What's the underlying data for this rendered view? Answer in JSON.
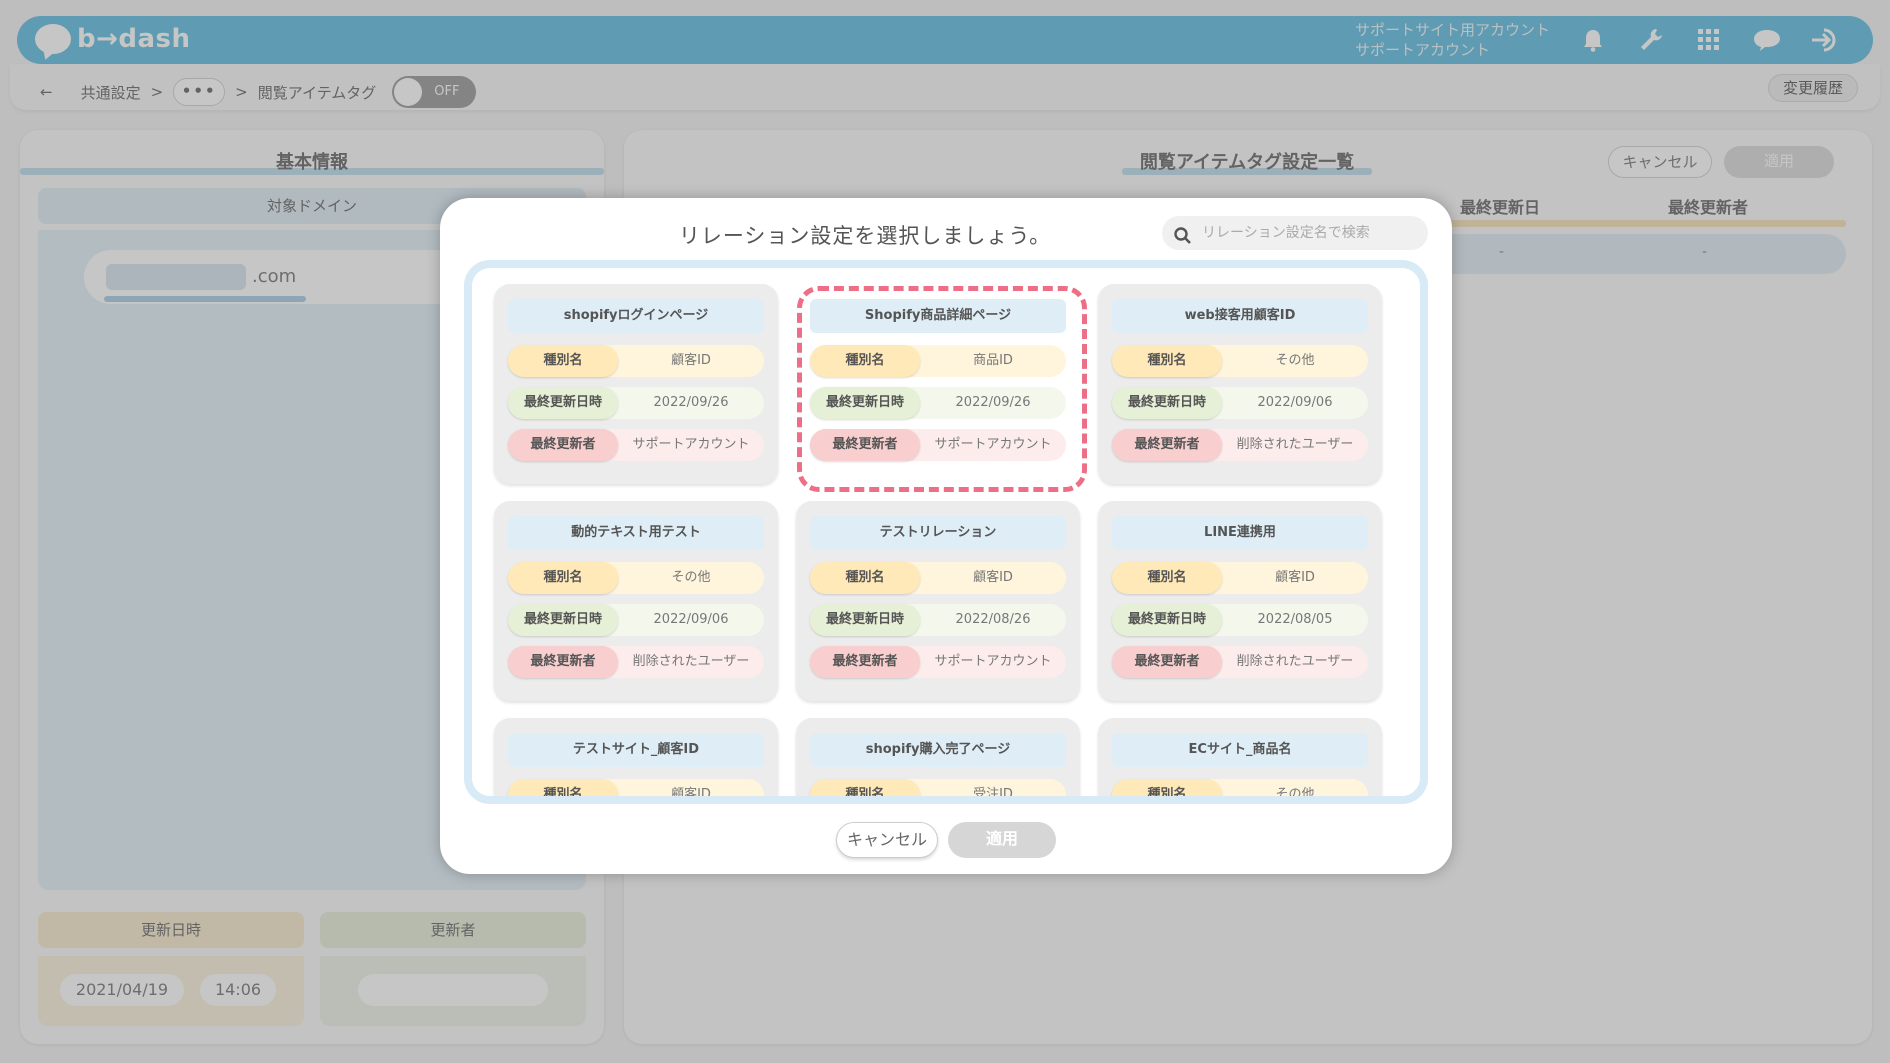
{
  "header": {
    "logo_text": "b→dash",
    "account_site": "サポートサイト用アカウント",
    "account_user": "サポートアカウント",
    "icons": [
      "bell-icon",
      "wrench-icon",
      "grid-icon",
      "support-chat-icon",
      "logout-icon"
    ]
  },
  "subbar": {
    "back": "←",
    "crumb1": "共通設定",
    "sep": ">",
    "dots": "•••",
    "crumb2": "閲覧アイテムタグ",
    "toggle_label": "OFF",
    "history": "変更履歴"
  },
  "left": {
    "title": "基本情報",
    "domain_label": "対象ドメイン",
    "domain_value": ".com",
    "updated_at_label": "更新日時",
    "updated_by_label": "更新者",
    "date": "2021/04/19",
    "time": "14:06"
  },
  "right": {
    "title": "閲覧アイテムタグ設定一覧",
    "cancel": "キャンセル",
    "apply": "適用",
    "col_updated": "最終更新日",
    "col_updater": "最終更新者",
    "cell1": "-",
    "cell2": "-"
  },
  "modal": {
    "title": "リレーション設定を選択しましょう。",
    "search_placeholder": "リレーション設定名で検索",
    "cancel": "キャンセル",
    "apply": "適用",
    "row_labels": {
      "type": "種別名",
      "updated": "最終更新日時",
      "updater": "最終更新者"
    },
    "cards": [
      {
        "name": "shopifyログインページ",
        "type": "顧客ID",
        "updated": "2022/09/26",
        "updater": "サポートアカウント"
      },
      {
        "name": "Shopify商品詳細ページ",
        "type": "商品ID",
        "updated": "2022/09/26",
        "updater": "サポートアカウント",
        "selected": true
      },
      {
        "name": "web接客用顧客ID",
        "type": "その他",
        "updated": "2022/09/06",
        "updater": "削除されたユーザー"
      },
      {
        "name": "動的テキスト用テスト",
        "type": "その他",
        "updated": "2022/09/06",
        "updater": "削除されたユーザー"
      },
      {
        "name": "テストリレーション",
        "type": "顧客ID",
        "updated": "2022/08/26",
        "updater": "サポートアカウント"
      },
      {
        "name": "LINE連携用",
        "type": "顧客ID",
        "updated": "2022/08/05",
        "updater": "削除されたユーザー"
      },
      {
        "name": "テストサイト_顧客ID",
        "type": "顧客ID",
        "updated": "",
        "updater": ""
      },
      {
        "name": "shopify購入完了ページ",
        "type": "受注ID",
        "updated": "",
        "updater": ""
      },
      {
        "name": "ECサイト_商品名",
        "type": "その他",
        "updated": "",
        "updater": ""
      }
    ]
  }
}
